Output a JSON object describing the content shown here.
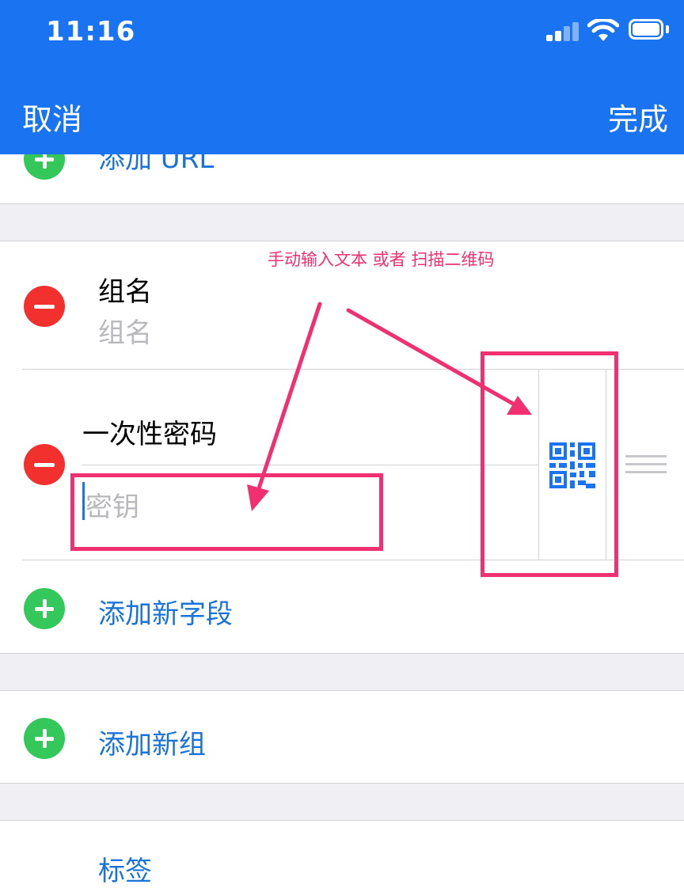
{
  "status_bar": {
    "time": "11:16"
  },
  "nav": {
    "cancel_label": "取消",
    "done_label": "完成"
  },
  "rows": {
    "add_url": "添加 URL",
    "group_name_label": "组名",
    "group_name_placeholder": "组名",
    "otp_label": "一次性密码",
    "otp_key_placeholder": "密钥",
    "add_field": "添加新字段",
    "add_group": "添加新组",
    "tags": "标签"
  },
  "annotation": {
    "text": "手动输入文本 或者 扫描二维码"
  },
  "colors": {
    "accent": "#1a73f0",
    "annotation": "#f03071",
    "add": "#34c759",
    "remove": "#f2312e"
  }
}
